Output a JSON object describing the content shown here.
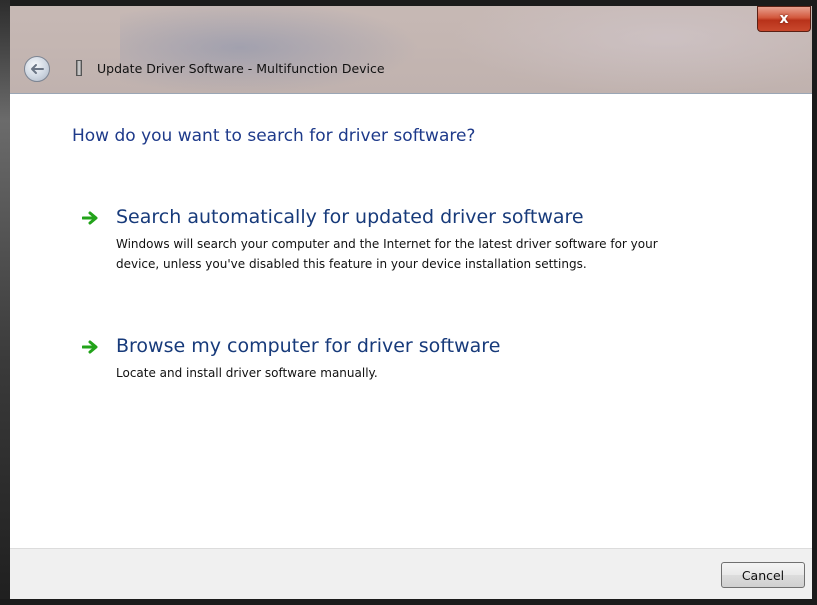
{
  "window": {
    "title": "Update Driver Software - Multifunction Device",
    "close_label": "x",
    "back_icon": "back-arrow-icon",
    "device_icon": "multifunction-device-icon"
  },
  "main": {
    "heading": "How do you want to search for driver software?",
    "options": [
      {
        "icon": "green-arrow-icon",
        "title": "Search automatically for updated driver software",
        "description": "Windows will search your computer and the Internet for the latest driver software for your device, unless you've disabled this feature in your device installation settings."
      },
      {
        "icon": "green-arrow-icon",
        "title": "Browse my computer for driver software",
        "description": "Locate and install driver software manually."
      }
    ]
  },
  "footer": {
    "cancel_label": "Cancel"
  },
  "colors": {
    "heading": "#1e3a8a",
    "option_title": "#173a7a",
    "arrow_green": "#22a31a",
    "close_red": "#c9482d",
    "footer_bg": "#f0f0f0"
  }
}
